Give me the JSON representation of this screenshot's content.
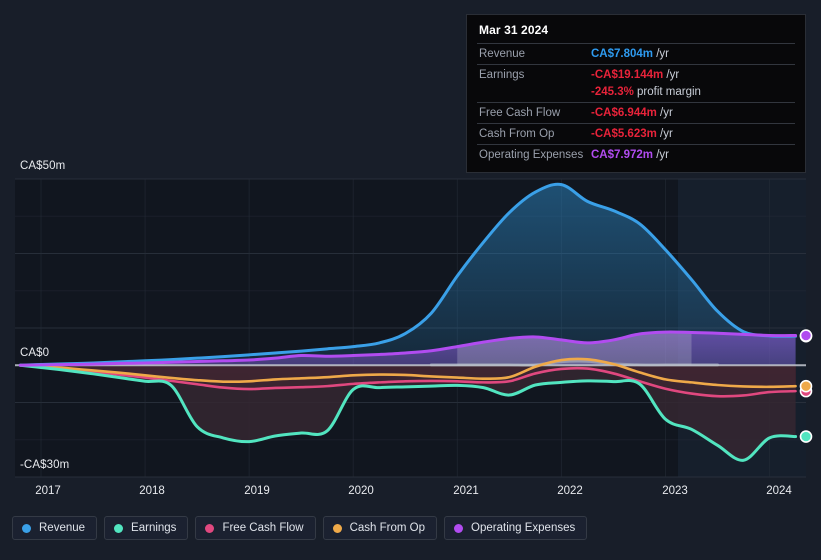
{
  "tooltip": {
    "date": "Mar 31 2024",
    "rows": [
      {
        "key": "Revenue",
        "value": "CA$7.804m",
        "unit": "/yr",
        "color": "#2e9bf0",
        "sub": null
      },
      {
        "key": "Earnings",
        "value": "-CA$19.144m",
        "unit": "/yr",
        "color": "#e8233a",
        "sub": null
      },
      {
        "key": "",
        "value": "-245.3%",
        "unit": "profit margin",
        "color": "#e8233a",
        "sub": true
      },
      {
        "key": "Free Cash Flow",
        "value": "-CA$6.944m",
        "unit": "/yr",
        "color": "#e8233a",
        "sub": null
      },
      {
        "key": "Cash From Op",
        "value": "-CA$5.623m",
        "unit": "/yr",
        "color": "#e8233a",
        "sub": null
      },
      {
        "key": "Operating Expenses",
        "value": "CA$7.972m",
        "unit": "/yr",
        "color": "#b14cf0",
        "sub": null
      }
    ]
  },
  "axes": {
    "y_labels": [
      "CA$50m",
      "CA$0",
      "-CA$30m"
    ],
    "x_labels": [
      "2017",
      "2018",
      "2019",
      "2020",
      "2021",
      "2022",
      "2023",
      "2024"
    ]
  },
  "legend": [
    {
      "label": "Revenue",
      "color": "#3aa0e8"
    },
    {
      "label": "Earnings",
      "color": "#52e5c0"
    },
    {
      "label": "Free Cash Flow",
      "color": "#e0487f"
    },
    {
      "label": "Cash From Op",
      "color": "#efa949"
    },
    {
      "label": "Operating Expenses",
      "color": "#b14cf0"
    }
  ],
  "chart_data": {
    "type": "area",
    "title": "",
    "xlabel": "",
    "ylabel": "CA$ millions",
    "ylim": [
      -30,
      50
    ],
    "xlim": [
      2016.75,
      2024.35
    ],
    "grid": true,
    "legend_position": "bottom-left",
    "currency": "CA$",
    "units": "millions",
    "x": [
      2016.8,
      2017.0,
      2017.25,
      2017.5,
      2017.75,
      2018.0,
      2018.25,
      2018.5,
      2018.75,
      2019.0,
      2019.25,
      2019.5,
      2019.75,
      2020.0,
      2020.25,
      2020.5,
      2020.75,
      2021.0,
      2021.25,
      2021.5,
      2021.75,
      2022.0,
      2022.25,
      2022.5,
      2022.75,
      2023.0,
      2023.25,
      2023.5,
      2023.75,
      2024.0,
      2024.25
    ],
    "series": [
      {
        "name": "Revenue",
        "color": "#3aa0e8",
        "values": [
          0.0,
          0.2,
          0.4,
          0.6,
          0.9,
          1.2,
          1.5,
          1.9,
          2.3,
          2.8,
          3.3,
          3.8,
          4.4,
          5.0,
          6.0,
          8.5,
          14.0,
          24.0,
          33.0,
          41.0,
          46.5,
          48.5,
          44.0,
          41.5,
          38.0,
          31.0,
          23.0,
          14.5,
          9.0,
          7.9,
          7.804
        ],
        "end_value": 7.804
      },
      {
        "name": "Earnings",
        "color": "#52e5c0",
        "values": [
          0.0,
          -0.6,
          -1.4,
          -2.3,
          -3.3,
          -4.3,
          -5.4,
          -16.5,
          -19.5,
          -20.5,
          -19.0,
          -18.2,
          -17.6,
          -6.5,
          -6.0,
          -5.8,
          -5.6,
          -5.4,
          -6.0,
          -8.0,
          -5.3,
          -4.6,
          -4.2,
          -4.4,
          -5.0,
          -14.5,
          -17.2,
          -21.5,
          -25.5,
          -19.5,
          -19.144
        ],
        "end_value": -19.144
      },
      {
        "name": "Free Cash Flow",
        "color": "#e0487f",
        "values": [
          0.0,
          -0.4,
          -1.0,
          -1.7,
          -2.5,
          -3.3,
          -4.2,
          -5.1,
          -6.0,
          -6.4,
          -6.1,
          -5.9,
          -5.6,
          -5.0,
          -4.6,
          -4.3,
          -4.2,
          -4.3,
          -4.6,
          -4.3,
          -2.2,
          -1.0,
          -0.9,
          -2.2,
          -4.3,
          -6.3,
          -7.6,
          -8.3,
          -8.1,
          -7.2,
          -6.944
        ],
        "end_value": -6.944
      },
      {
        "name": "Cash From Op",
        "color": "#efa949",
        "values": [
          0.0,
          -0.3,
          -0.8,
          -1.4,
          -2.0,
          -2.7,
          -3.4,
          -4.0,
          -4.4,
          -4.3,
          -3.8,
          -3.5,
          -3.2,
          -2.7,
          -2.5,
          -2.6,
          -3.0,
          -3.3,
          -3.6,
          -3.2,
          -0.4,
          1.4,
          1.6,
          0.3,
          -1.9,
          -3.8,
          -4.6,
          -5.3,
          -5.7,
          -5.8,
          -5.623
        ],
        "end_value": -5.623
      },
      {
        "name": "Operating Expenses",
        "color": "#b14cf0",
        "values": [
          0.0,
          0.1,
          0.2,
          0.3,
          0.5,
          0.6,
          0.8,
          1.0,
          1.2,
          1.4,
          1.9,
          2.6,
          2.4,
          2.6,
          2.9,
          3.3,
          3.9,
          5.0,
          6.2,
          7.2,
          7.6,
          6.8,
          6.0,
          6.8,
          8.4,
          8.9,
          8.8,
          8.6,
          8.3,
          8.0,
          7.972
        ],
        "end_value": 7.972
      }
    ],
    "yticks": [
      50,
      0,
      -30
    ],
    "xticks": [
      2017,
      2018,
      2019,
      2020,
      2021,
      2022,
      2023,
      2024
    ],
    "highlight_region": {
      "from": 2023.12,
      "to": 2024.35
    }
  }
}
